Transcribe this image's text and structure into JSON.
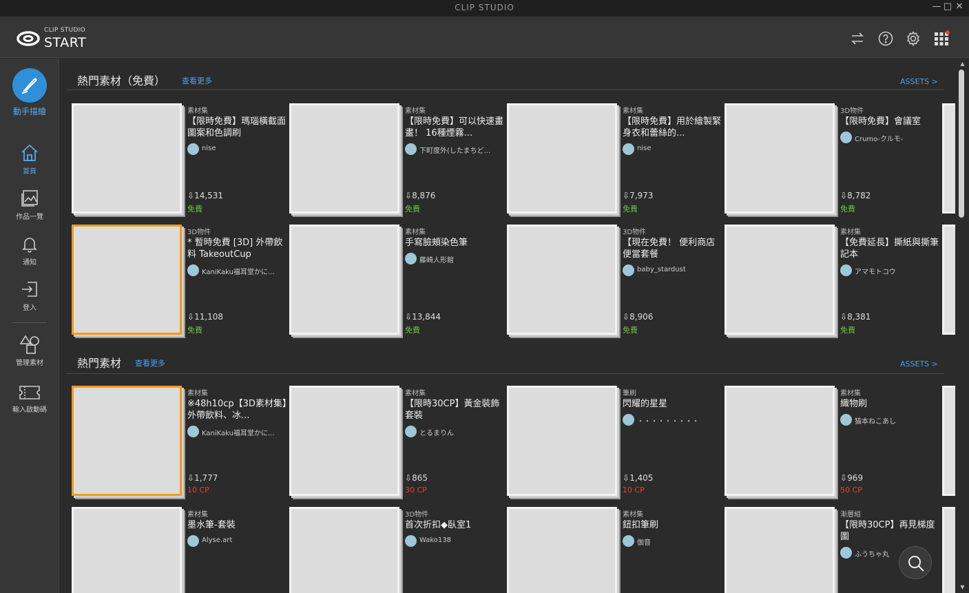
{
  "window": {
    "title": "CLIP STUDIO",
    "min": "—",
    "max": "□",
    "close": "✕"
  },
  "header": {
    "logo_top": "CLIP STUDIO",
    "logo_main": "START"
  },
  "sidebar": {
    "draw_label": "動手描繪",
    "items": [
      {
        "label": "首頁"
      },
      {
        "label": "作品一覽"
      },
      {
        "label": "通知"
      },
      {
        "label": "登入"
      },
      {
        "label": "管理素材"
      },
      {
        "label": "輸入啟動碼"
      }
    ]
  },
  "sections": [
    {
      "title": "熱門素材（免費）",
      "more": "查看更多",
      "assets": "ASSETS >",
      "rows": [
        [
          {
            "cat": "素材集",
            "name": "【限時免費】瑪瑙橫截面圖案和色調刷",
            "author": "nise",
            "dl": "14,531",
            "price": "免費"
          },
          {
            "cat": "素材集",
            "name": "【限時免費】可以快速畫畫！ 16種煙霧...",
            "author": "下町度外(したまちど...",
            "dl": "8,876",
            "price": "免費"
          },
          {
            "cat": "素材集",
            "name": "【限時免費】用於繪製緊身衣和蕾絲的...",
            "author": "nise",
            "dl": "7,973",
            "price": "免費"
          },
          {
            "cat": "3D物件",
            "name": "【限時免費】會議室",
            "author": "Crumo-クルモ-",
            "dl": "8,782",
            "price": "免費"
          }
        ],
        [
          {
            "cat": "3D物件",
            "name": "* 暫時免費 [3D] 外帶飲料 TakeoutCup",
            "author": "KaniKaku福耳堂かに...",
            "dl": "11,108",
            "price": "免費"
          },
          {
            "cat": "素材集",
            "name": "手寫臉頰染色筆",
            "author": "藤崎人形館",
            "dl": "13,844",
            "price": "免費"
          },
          {
            "cat": "3D物件",
            "name": "【現在免費！ 便利商店便當套餐",
            "author": "baby_stardust",
            "dl": "8,906",
            "price": "免費"
          },
          {
            "cat": "素材集",
            "name": "【免費延長】撕紙與撕筆記本",
            "author": "アマモトコウ",
            "dl": "8,381",
            "price": "免費"
          }
        ]
      ]
    },
    {
      "title": "熱門素材",
      "more": "查看更多",
      "assets": "ASSETS >",
      "rows": [
        [
          {
            "cat": "素材集",
            "name": "※48h10cp【3D素材集】外帶飲料、冰...",
            "author": "KaniKaku福耳堂かに...",
            "dl": "1,777",
            "price": "10 CP"
          },
          {
            "cat": "素材集",
            "name": "【限時30CP】黃金裝飾套裝",
            "author": "とるまりん",
            "dl": "865",
            "price": "30 CP"
          },
          {
            "cat": "筆刷",
            "name": "閃耀的星星",
            "author": "・・・・・・・・・",
            "dl": "1,405",
            "price": "10 CP"
          },
          {
            "cat": "素材集",
            "name": "織物刷",
            "author": "猫本ねこあし",
            "dl": "969",
            "price": "50 CP"
          }
        ],
        [
          {
            "cat": "素材集",
            "name": "墨水筆-套裝",
            "author": "Alyse.art",
            "dl": "",
            "price": ""
          },
          {
            "cat": "3D物件",
            "name": "首次折扣◆臥室1",
            "author": "Wako138",
            "dl": "",
            "price": ""
          },
          {
            "cat": "素材集",
            "name": "鈕扣筆刷",
            "author": "伽音",
            "dl": "",
            "price": ""
          },
          {
            "cat": "漸層組",
            "name": "【限時30CP】再見梯度圖",
            "author": "ふうちゃ丸",
            "dl": "",
            "price": ""
          }
        ]
      ]
    }
  ],
  "colors": {
    "accent": "#2f8fd8",
    "link": "#4aa0f0",
    "free": "#6dc442",
    "cp": "#e8412e"
  },
  "icons": [
    "switch-icon",
    "help-icon",
    "gear-icon",
    "apps-grid-icon",
    "brush-icon",
    "home-icon",
    "gallery-icon",
    "bell-icon",
    "login-icon",
    "shapes-icon",
    "ticket-icon",
    "search-icon"
  ]
}
